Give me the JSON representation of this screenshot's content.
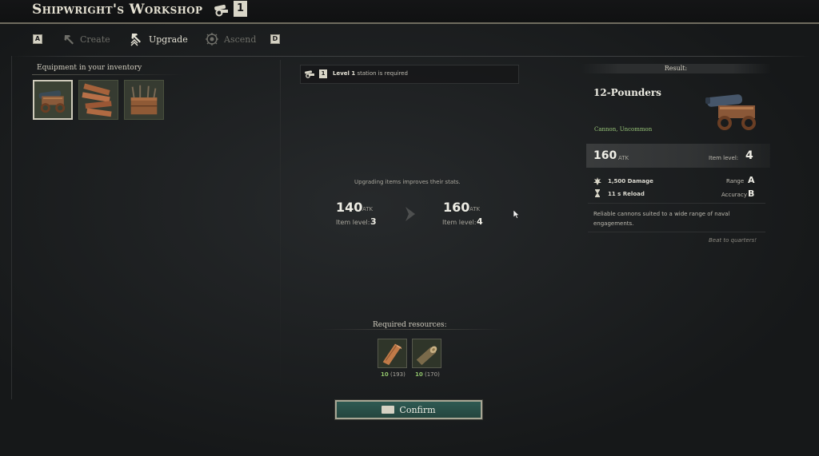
{
  "header": {
    "title": "Shipwright's Workshop",
    "tier": "1"
  },
  "tabs": [
    {
      "key": "A",
      "label": "Create",
      "icon": "hammer-icon",
      "active": false
    },
    {
      "key": "",
      "label": "Upgrade",
      "icon": "upgrade-hammer-icon",
      "active": true
    },
    {
      "key": "",
      "label": "Ascend",
      "icon": "ascend-emblem-icon",
      "active": false
    },
    {
      "key": "D",
      "label": "",
      "icon": "",
      "active": false
    }
  ],
  "inventory": {
    "title": "Equipment in your inventory",
    "items": [
      {
        "name": "cannon-item",
        "selected": true
      },
      {
        "name": "planks-item",
        "selected": false
      },
      {
        "name": "crate-item",
        "selected": false
      }
    ]
  },
  "requirement": {
    "level_text": "Level 1",
    "suffix": " station is required",
    "tier": "1"
  },
  "upgrade": {
    "hint": "Upgrading items improves their stats.",
    "from": {
      "atk": "140",
      "unit": "ATK",
      "level_label": "Item level:",
      "level": "3"
    },
    "to": {
      "atk": "160",
      "unit": "ATK",
      "level_label": "Item level:",
      "level": "4"
    }
  },
  "resources": {
    "title": "Required resources:",
    "items": [
      {
        "name": "lumber",
        "needed": "10",
        "have": "(193)"
      },
      {
        "name": "log",
        "needed": "10",
        "have": "(170)"
      }
    ]
  },
  "confirm": {
    "label": "Confirm"
  },
  "result": {
    "header": "Result:",
    "name": "12-Pounders",
    "rarity": "Cannon, Uncommon",
    "atk": "160",
    "atk_unit": "ATK",
    "level_label": "Item level:",
    "level": "4",
    "damage": "1,500 Damage",
    "reload": "11 s Reload",
    "range_label": "Range",
    "range_grade": "A",
    "accuracy_label": "Accuracy",
    "accuracy_grade": "B",
    "description": "Reliable cannons suited to a wide range of naval engagements.",
    "flavor": "Beat to quarters!"
  },
  "colors": {
    "accent_green": "#8fc26a",
    "confirm_teal": "#2e5a53",
    "rarity_green": "#97c478"
  }
}
